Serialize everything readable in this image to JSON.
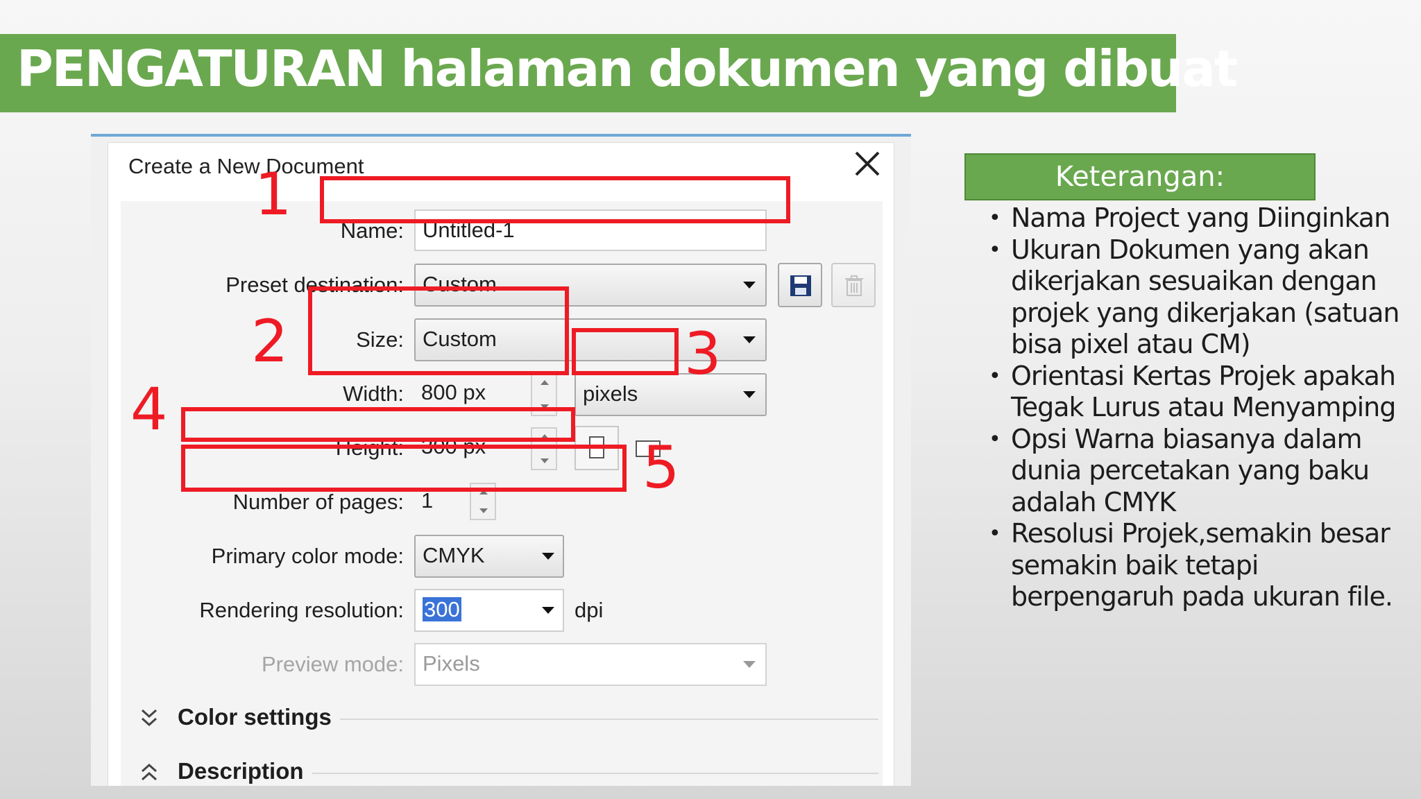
{
  "slide": {
    "title": "PENGATURAN halaman dokumen yang dibuat"
  },
  "dialog": {
    "title": "Create a New Document",
    "name": {
      "label": "Name:",
      "value": "Untitled-1"
    },
    "preset": {
      "label": "Preset destination:",
      "value": "Custom"
    },
    "size": {
      "label": "Size:",
      "value": "Custom"
    },
    "width": {
      "label": "Width:",
      "value": "800 px",
      "unit": "pixels"
    },
    "height": {
      "label": "Height:",
      "value": "300 px"
    },
    "pages": {
      "label": "Number of pages:",
      "value": "1"
    },
    "color_mode": {
      "label": "Primary color mode:",
      "value": "CMYK"
    },
    "resolution": {
      "label": "Rendering resolution:",
      "value": "300",
      "unit": "dpi"
    },
    "preview": {
      "label": "Preview mode:",
      "value": "Pixels"
    },
    "sections": {
      "color_settings": "Color settings",
      "description": "Description"
    }
  },
  "annotations": {
    "n1": "1",
    "n2": "2",
    "n3": "3",
    "n4": "4",
    "n5": "5",
    "color": "#ee1b24"
  },
  "legend": {
    "title": "Keterangan:",
    "items": [
      "Nama Project yang Diinginkan",
      "Ukuran Dokumen yang akan dikerjakan sesuaikan dengan projek yang dikerjakan (satuan bisa pixel atau CM)",
      "Orientasi Kertas Projek apakah Tegak Lurus atau Menyamping",
      "Opsi Warna biasanya dalam dunia percetakan yang baku adalah CMYK",
      "Resolusi Projek,semakin besar semakin baik tetapi berpengaruh pada ukuran file."
    ]
  },
  "colors": {
    "header_green": "#6aa84f",
    "annotation_red": "#ee1b24"
  }
}
